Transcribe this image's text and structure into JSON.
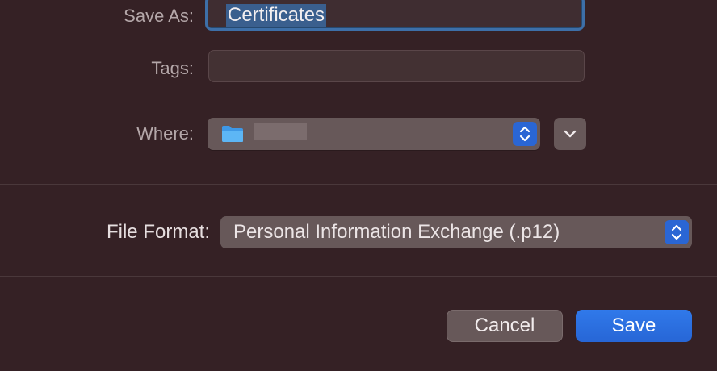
{
  "form": {
    "save_as_label": "Save As:",
    "save_as_value": "Certificates",
    "tags_label": "Tags:",
    "tags_value": "",
    "where_label": "Where:",
    "where_value": "",
    "file_format_label": "File Format:",
    "file_format_value": "Personal Information Exchange (.p12)"
  },
  "buttons": {
    "cancel": "Cancel",
    "save": "Save"
  },
  "icons": {
    "where": "folder-icon",
    "where_stepper": "updown-chevron-icon",
    "expand": "chevron-down-icon",
    "format_stepper": "updown-chevron-icon"
  },
  "colors": {
    "background": "#352125",
    "accent": "#2b6fe0",
    "focus_ring": "#3d6fa8",
    "folder": "#4aa8f0"
  }
}
